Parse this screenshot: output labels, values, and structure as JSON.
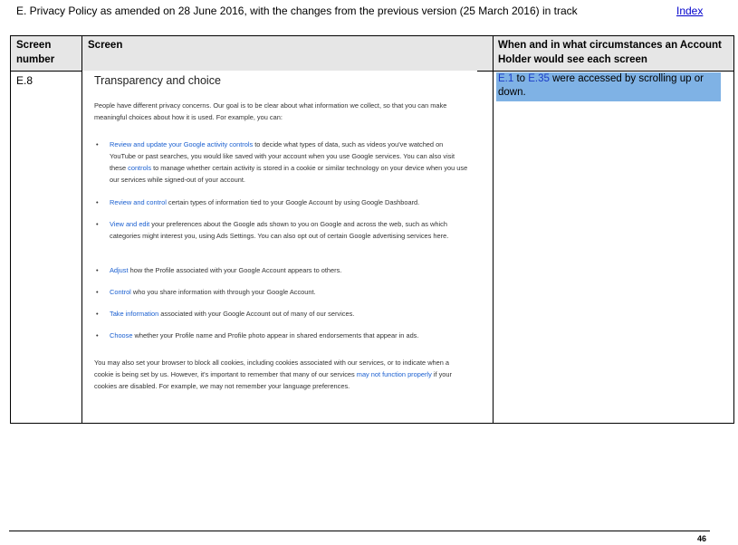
{
  "header": {
    "title": "E. Privacy Policy as amended on 28 June 2016, with the changes from the previous version (25 March 2016) in track",
    "index_link": "Index"
  },
  "table": {
    "col1_header": "Screen number",
    "col2_header": "Screen",
    "col3_header": "When and in what circumstances an Account Holder would see each screen",
    "row": {
      "screen_number": "E.8",
      "circumstance": {
        "ref_start": "E.1",
        "connector": " to ",
        "ref_end": "E.35",
        "rest": " were accessed by scrolling up or down."
      }
    }
  },
  "screenshot": {
    "heading": "Transparency and choice",
    "intro": "People have different privacy concerns. Our goal is to be clear about what information we collect, so that you can make meaningful choices about how it is used. For example, you can:",
    "items": [
      {
        "link": "Review and update your Google activity controls",
        "text": " to decide what types of data, such as videos you've watched on YouTube or past searches, you would like saved with your account when you use Google services. You can also visit these ",
        "link2": "controls",
        "text2": " to manage whether certain activity is stored in a cookie or similar technology on your device when you use our services while signed-out of your account."
      },
      {
        "link": "Review and control",
        "text": " certain types of information tied to your Google Account by using Google Dashboard."
      },
      {
        "link": "View and edit",
        "text": " your preferences about the Google ads shown to you on Google and across the web, such as which categories might interest you, using Ads Settings. You can also opt out of certain Google advertising services here."
      },
      {
        "link": "Adjust",
        "text": " how the Profile associated with your Google Account appears to others."
      },
      {
        "link": "Control",
        "text": " who you share information with through your Google Account."
      },
      {
        "link": "Take information",
        "text": " associated with your Google Account out of many of our services."
      },
      {
        "link": "Choose",
        "text": " whether your Profile name and Profile photo appear in shared endorsements that appear in ads."
      }
    ],
    "bullet_char": "•",
    "outro_text": "You may also set your browser to block all cookies, including cookies associated with our services, or to indicate when a cookie is being set by us. However, it's important to remember that many of our services ",
    "outro_link": "may not function properly",
    "outro_text2": " if your cookies are disabled. For example, we may not remember your language preferences."
  },
  "footer": {
    "page_number": "46"
  }
}
